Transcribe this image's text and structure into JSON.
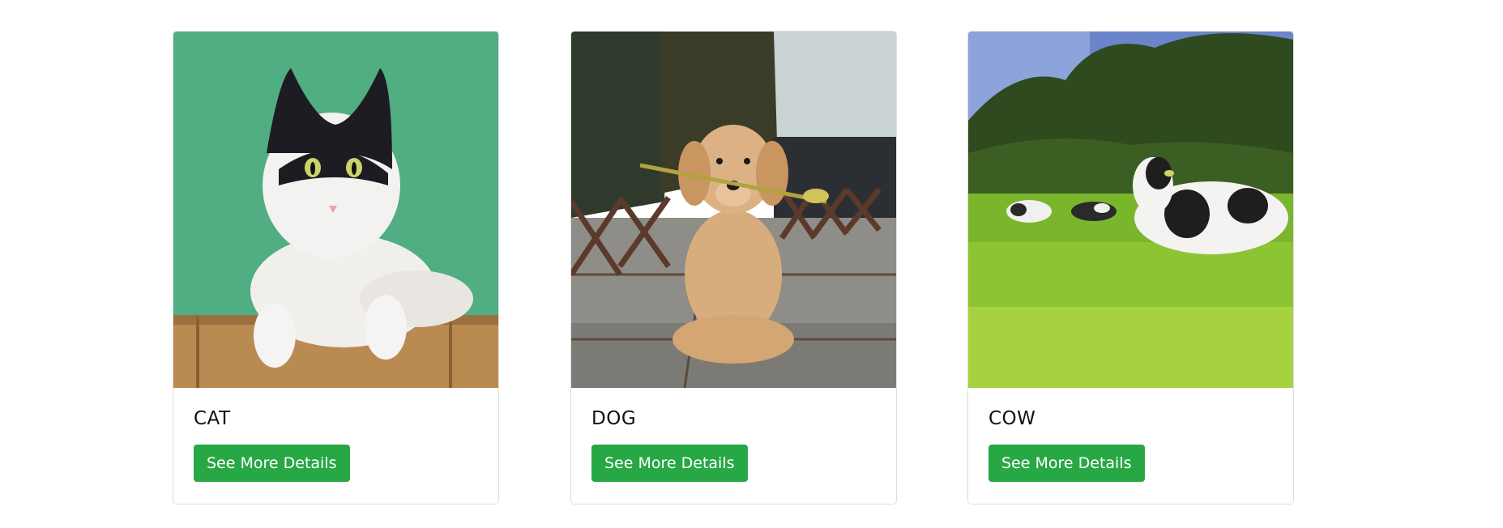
{
  "cards": [
    {
      "title": "CAT",
      "button_label": "See More Details",
      "image": "cat-photo"
    },
    {
      "title": "DOG",
      "button_label": "See More Details",
      "image": "dog-photo"
    },
    {
      "title": "COW",
      "button_label": "See More Details",
      "image": "cow-photo"
    }
  ],
  "colors": {
    "button_bg": "#28a745",
    "card_border": "#dfdfdf"
  }
}
